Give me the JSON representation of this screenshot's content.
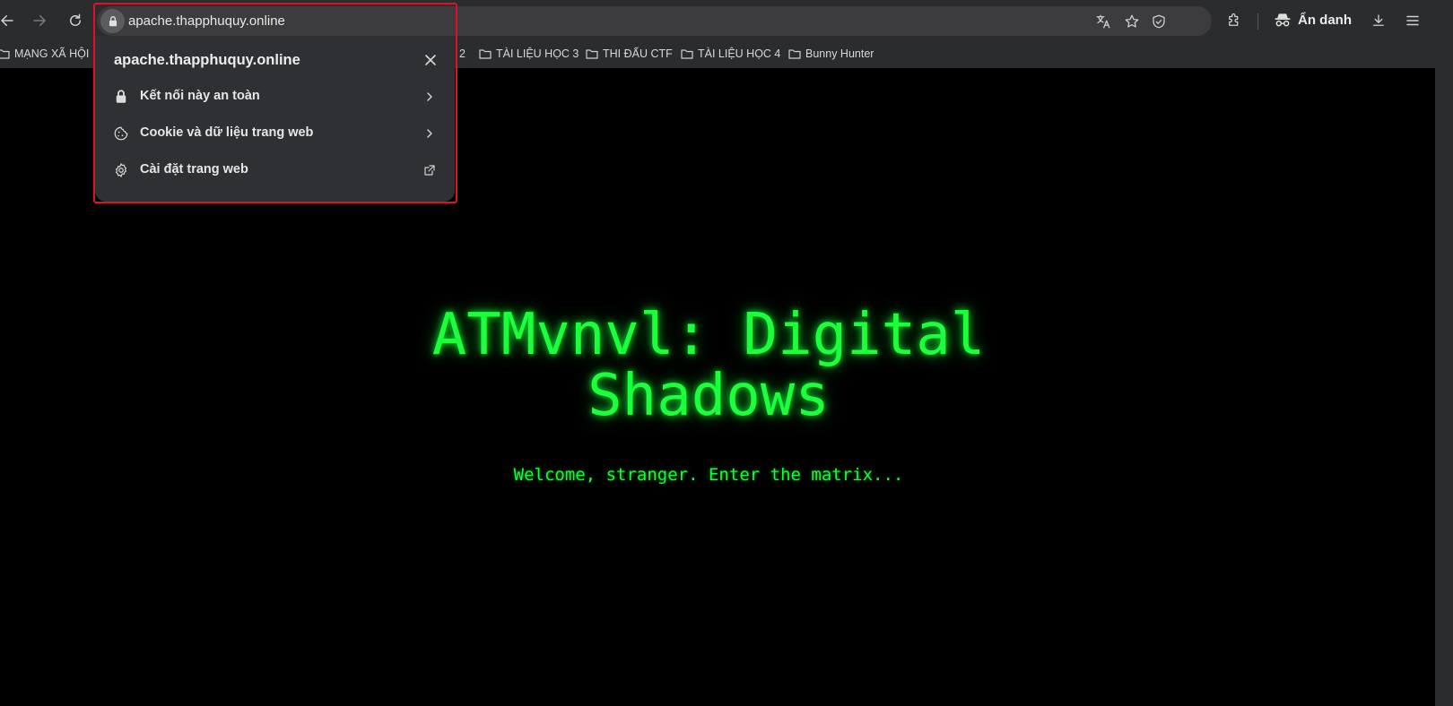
{
  "browser": {
    "url": "apache.thapphuquy.online",
    "incognito_label": "Ẩn danh"
  },
  "bookmarks": [
    {
      "label": "MẠNG XÃ HỘI"
    },
    {
      "label": "2"
    },
    {
      "label": "TÀI LIỆU HỌC 3"
    },
    {
      "label": "THI ĐẤU CTF"
    },
    {
      "label": "TÀI LIỆU HỌC 4"
    },
    {
      "label": "Bunny Hunter"
    }
  ],
  "site_info_popup": {
    "title": "apache.thapphuquy.online",
    "items": [
      {
        "label": "Kết nối này an toàn",
        "icon": "lock-icon"
      },
      {
        "label": "Cookie và dữ liệu trang web",
        "icon": "cookie-icon"
      },
      {
        "label": "Cài đặt trang web",
        "icon": "settings-icon"
      }
    ],
    "highlight_color": "#e01026"
  },
  "page": {
    "title_line1": "ATMvnvl: Digital",
    "title_line2": "Shadows",
    "subtitle": "Welcome, stranger. Enter the matrix...",
    "accent_color": "#1bff3c"
  }
}
